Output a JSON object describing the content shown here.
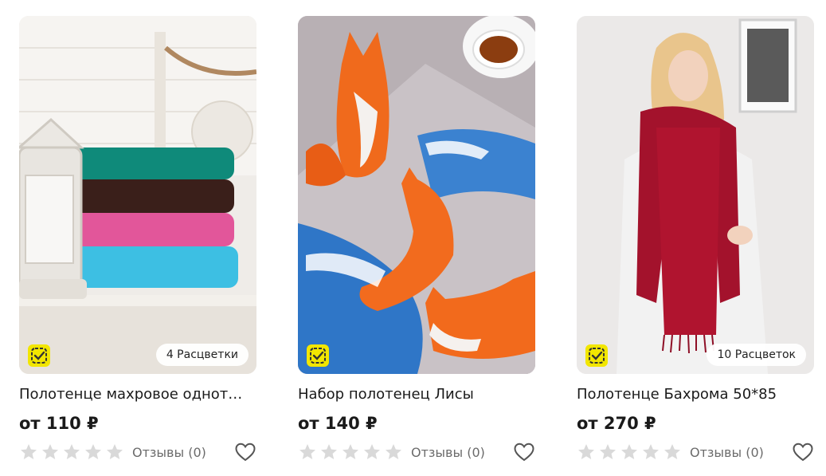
{
  "products": [
    {
      "title": "Полотенце махровое однот…",
      "price": "от 110 ₽",
      "colors_badge": "4 Расцветки",
      "reviews": "Отзывы (0)",
      "rating": 0,
      "image": "stacked-towels-photo"
    },
    {
      "title": "Набор полотенец Лисы",
      "price": "от 140 ₽",
      "colors_badge": "",
      "reviews": "Отзывы (0)",
      "rating": 0,
      "image": "fox-print-towels-photo"
    },
    {
      "title": "Полотенце Бахрома 50*85",
      "price": "от 270 ₽",
      "colors_badge": "10 Расцветок",
      "reviews": "Отзывы (0)",
      "rating": 0,
      "image": "woman-red-towel-photo"
    }
  ],
  "colors": {
    "verified_badge": "#f2e600",
    "star_empty": "#d9d9d9",
    "text_muted": "#6b6b6b"
  },
  "icons": {
    "verified": "verified-check-icon",
    "star": "star-icon",
    "favorite": "heart-outline-icon"
  }
}
